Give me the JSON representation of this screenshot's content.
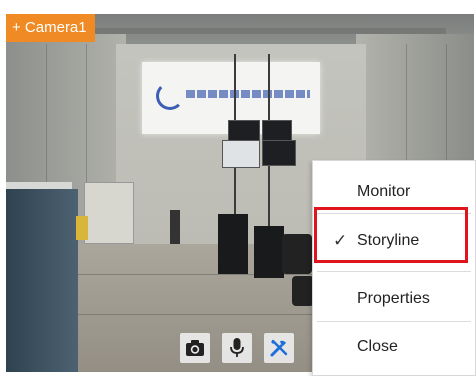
{
  "camera": {
    "label": "+ Camera1"
  },
  "toolbar": {
    "buttons": [
      {
        "name": "snapshot",
        "icon": "camera-icon"
      },
      {
        "name": "microphone",
        "icon": "microphone-icon"
      },
      {
        "name": "settings",
        "icon": "tools-icon"
      }
    ]
  },
  "context_menu": {
    "items": [
      {
        "label": "Monitor",
        "checked": false
      },
      {
        "label": "Storyline",
        "checked": true
      },
      {
        "label": "Properties",
        "checked": false
      },
      {
        "label": "Close",
        "checked": false
      }
    ],
    "check_mark": "✓"
  },
  "colors": {
    "camera_label_bg": "#f08a24",
    "highlight": "#e0141c",
    "tool_icon": "#1e6fd9"
  }
}
